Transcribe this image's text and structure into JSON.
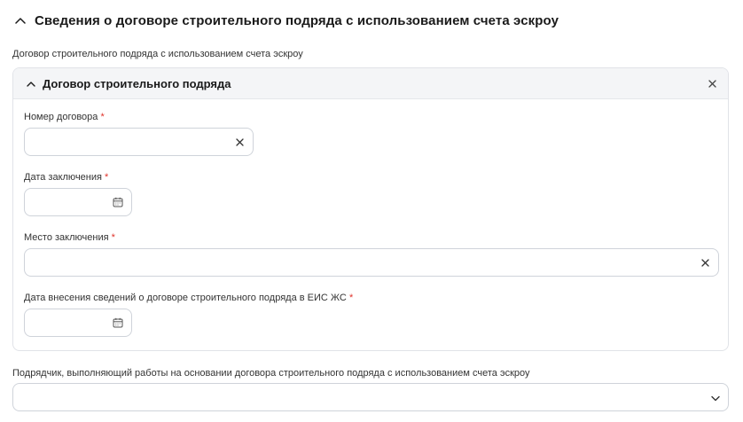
{
  "section": {
    "title": "Сведения о договоре строительного подряда с использованием счета эскроу"
  },
  "group": {
    "label": "Договор строительного подряда с использованием счета эскроу"
  },
  "card": {
    "title": "Договор строительного подряда"
  },
  "fields": {
    "contract_number": {
      "label": "Номер договора",
      "required_mark": "*",
      "value": ""
    },
    "conclusion_date": {
      "label": "Дата заключения",
      "required_mark": "*",
      "value": ""
    },
    "conclusion_place": {
      "label": "Место заключения",
      "required_mark": "*",
      "value": ""
    },
    "eis_date": {
      "label": "Дата внесения сведений о договоре строительного подряда в ЕИС ЖС",
      "required_mark": "*",
      "value": ""
    }
  },
  "contractor": {
    "label": "Подрядчик, выполняющий работы на основании договора строительного подряда с использованием счета эскроу",
    "selected": ""
  },
  "icons": {
    "section_toggle": "chevron-up-icon",
    "card_toggle": "chevron-up-icon",
    "card_remove": "close-icon",
    "clear": "close-icon",
    "calendar": "calendar-icon",
    "dropdown": "chevron-down-icon"
  },
  "colors": {
    "required": "#e0332b",
    "border": "#cfd3da",
    "card_header_bg": "#f4f5f7"
  }
}
